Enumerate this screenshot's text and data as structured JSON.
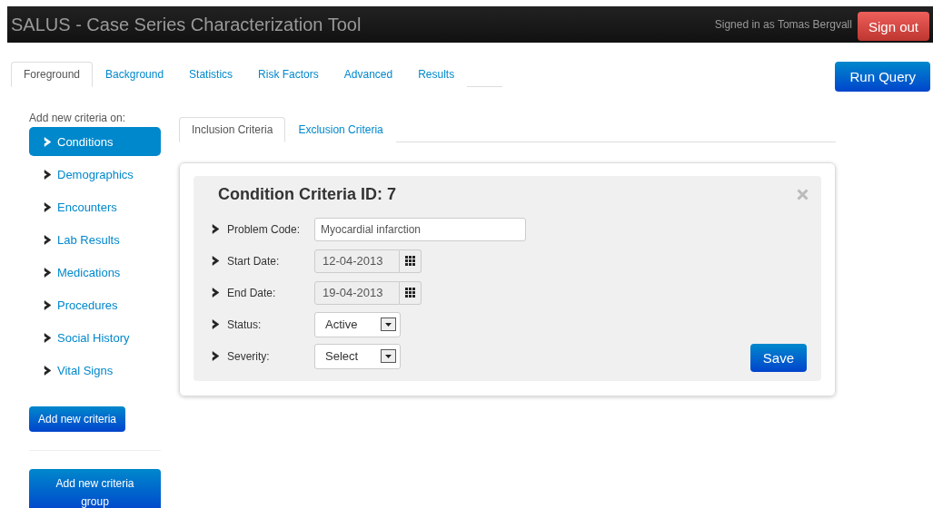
{
  "navbar": {
    "title": "SALUS - Case Series Characterization Tool",
    "signed_in": "Signed in as Tomas Bergvall",
    "sign_out": "Sign out"
  },
  "tabs": [
    {
      "label": "Foreground",
      "selected": true
    },
    {
      "label": "Background",
      "selected": false
    },
    {
      "label": "Statistics",
      "selected": false
    },
    {
      "label": "Risk Factors",
      "selected": false
    },
    {
      "label": "Advanced",
      "selected": false
    },
    {
      "label": "Results",
      "selected": false
    }
  ],
  "run_query": "Run Query",
  "sidebar": {
    "heading": "Add new criteria on:",
    "items": [
      {
        "label": "Conditions",
        "selected": true
      },
      {
        "label": "Demographics",
        "selected": false
      },
      {
        "label": "Encounters",
        "selected": false
      },
      {
        "label": "Lab Results",
        "selected": false
      },
      {
        "label": "Medications",
        "selected": false
      },
      {
        "label": "Procedures",
        "selected": false
      },
      {
        "label": "Social History",
        "selected": false
      },
      {
        "label": "Vital Signs",
        "selected": false
      }
    ],
    "add_button": "Add new criteria",
    "group_button": "Add new criteria group"
  },
  "subtabs": [
    {
      "label": "Inclusion Criteria",
      "selected": true
    },
    {
      "label": "Exclusion Criteria",
      "selected": false
    }
  ],
  "criteria": {
    "title": "Condition Criteria ID: 7",
    "fields": [
      {
        "kind": "text",
        "label": "Problem Code:",
        "value": "Myocardial infarction"
      },
      {
        "kind": "date",
        "label": "Start Date:",
        "value": "12-04-2013"
      },
      {
        "kind": "date",
        "label": "End Date:",
        "value": "19-04-2013"
      },
      {
        "kind": "select",
        "label": "Status:",
        "value": "Active"
      },
      {
        "kind": "select",
        "label": "Severity:",
        "value": "Select"
      }
    ],
    "save": "Save"
  }
}
